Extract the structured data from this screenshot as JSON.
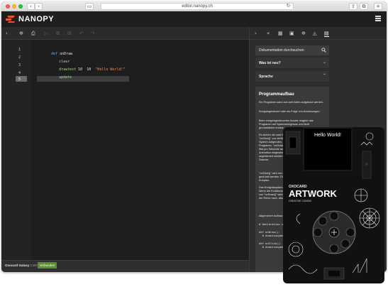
{
  "browser": {
    "url": "editor.nanopy.ch"
  },
  "app": {
    "brand": "NANOPY"
  },
  "toolbar": {
    "collapse_icon": "chevron-right-icon",
    "run_icon": "gear-icon",
    "save_icon": "printer-icon"
  },
  "editor": {
    "lines": [
      {
        "number": "1",
        "keyword": "def",
        "name": "onDraw"
      },
      {
        "number": "2",
        "command": "clear"
      },
      {
        "number": "3",
        "command": "drawtext",
        "arg1": "10",
        "arg2": "10",
        "string": "\"Hello World!\""
      },
      {
        "number": "4",
        "command": "update"
      },
      {
        "number": "5"
      }
    ]
  },
  "status": {
    "device": "Oxocard Galaxy",
    "device_id": "C4E08E",
    "connection": "verbunden"
  },
  "right_panel": {
    "search_placeholder": "Dokumentation durchsuchen",
    "sections": [
      {
        "label": "Was ist neu?",
        "state": "collapsed"
      },
      {
        "label": "Sprache",
        "state": "expanded"
      }
    ],
    "doc": {
      "title": "Programmaufbau",
      "p1": "Ein Programm kann auf zwei Arten aufgebaut werden.",
      "p2": "Ereignisgesteuert oder als Folge von Anweisungen.",
      "p3": "Beim ereignisgesteuerten Ansatz reagiert das Programm auf Systemereignisse und läuft grundsätzlich endlos.",
      "p4": "Es stehen die zwei Ereignisfunktionen \"onDraw()\" und \"onClick()\" zur Verfügung. \"onDraw()\" wird laufend vom System aufgerufen, das System unterbricht dafür das Programm. \"onDraw()\" je nach Anwendung bis zu 60 Mal pro Sekunde aufgerufen, jedoch auch direkt in der Animation eingesetzt werden, damit der Bildschirm angesteuert werden kann, allerdings auch für andere Zwecke.",
      "p5": "\"onClick()\" wird nur dann aufgerufen, wenn die Knöpfe gedrückt werden. Diese Funktion dient zur Abfrage von Knöpfen.",
      "p6": "Das Ereignissystem läuft, sobald die Karte gestartet ist. Wenn die Funktionen nicht definiert sind, denn Aufruf von \"onDraw()\" wird übersprungen. Die Aufrufe erfolgen der Reihe nach, also nicht parallel.",
      "p7": "Allgemeiner Aufbau:",
      "code1": "# Deklaration von Variablen",
      "code2": "def onDraw():\n  # Anweisungen",
      "code3": "def onClick():\n  # Anweisungen"
    }
  },
  "device": {
    "screen_text": "Hello World!",
    "brand": "OXOCARD",
    "title": "ARTWORK",
    "subtitle": "CREATIVE CODING"
  }
}
